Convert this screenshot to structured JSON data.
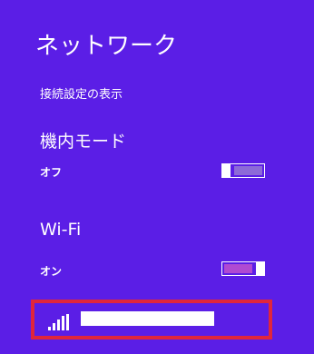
{
  "panel": {
    "title": "ネットワーク",
    "view_connection_settings": "接続設定の表示"
  },
  "airplane_mode": {
    "label": "機内モード",
    "state": "オフ"
  },
  "wifi": {
    "label": "Wi-Fi",
    "state": "オン"
  },
  "network_list": {
    "ssid": ""
  },
  "colors": {
    "background": "#5b1ee6",
    "highlight_frame": "#e0263c",
    "toggle_on_fill": "#b04ad2",
    "toggle_off_fill": "#8d6ad8"
  },
  "icons": {
    "signal": "wifi-signal-icon"
  }
}
